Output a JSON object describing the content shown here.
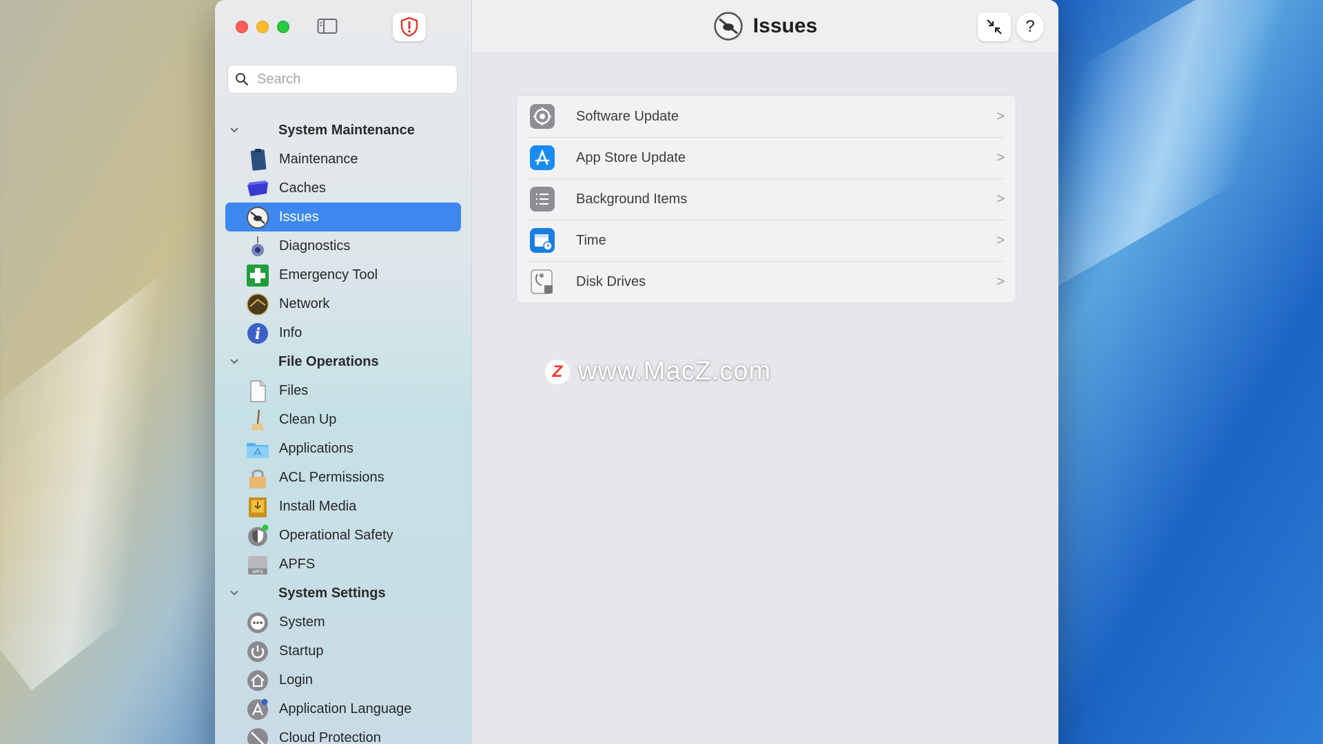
{
  "window": {
    "title": "Issues",
    "search_placeholder": "Search",
    "help_label": "?"
  },
  "sidebar": {
    "sections": [
      {
        "title": "System Maintenance",
        "items": [
          {
            "label": "Maintenance",
            "icon": "clipboard-icon"
          },
          {
            "label": "Caches",
            "icon": "caches-bin-icon"
          },
          {
            "label": "Issues",
            "icon": "issues-icon",
            "active": true
          },
          {
            "label": "Diagnostics",
            "icon": "diagnostics-icon"
          },
          {
            "label": "Emergency Tool",
            "icon": "first-aid-icon"
          },
          {
            "label": "Network",
            "icon": "network-globe-icon"
          },
          {
            "label": "Info",
            "icon": "info-icon"
          }
        ]
      },
      {
        "title": "File Operations",
        "items": [
          {
            "label": "Files",
            "icon": "document-icon"
          },
          {
            "label": "Clean Up",
            "icon": "broom-icon"
          },
          {
            "label": "Applications",
            "icon": "applications-folder-icon"
          },
          {
            "label": "ACL Permissions",
            "icon": "lock-icon"
          },
          {
            "label": "Install Media",
            "icon": "install-media-icon"
          },
          {
            "label": "Operational Safety",
            "icon": "shield-icon"
          },
          {
            "label": "APFS",
            "icon": "apfs-drive-icon"
          }
        ]
      },
      {
        "title": "System Settings",
        "items": [
          {
            "label": "System",
            "icon": "system-dots-icon"
          },
          {
            "label": "Startup",
            "icon": "power-icon"
          },
          {
            "label": "Login",
            "icon": "home-icon"
          },
          {
            "label": "Application Language",
            "icon": "language-icon"
          },
          {
            "label": "Cloud Protection",
            "icon": "cloud-protection-icon"
          }
        ]
      }
    ]
  },
  "main": {
    "rows": [
      {
        "label": "Software Update",
        "icon": "software-update-gear-icon"
      },
      {
        "label": "App Store Update",
        "icon": "app-store-icon"
      },
      {
        "label": "Background Items",
        "icon": "list-icon"
      },
      {
        "label": "Time",
        "icon": "calendar-clock-icon"
      },
      {
        "label": "Disk Drives",
        "icon": "disk-drive-icon"
      }
    ],
    "chevron": ">"
  },
  "watermark": {
    "badge": "Z",
    "text": "www.MacZ.com"
  },
  "colors": {
    "accent": "#3d88ef",
    "red_light": "#fe5f57",
    "yellow_light": "#febc2e",
    "green_light": "#28c840"
  }
}
